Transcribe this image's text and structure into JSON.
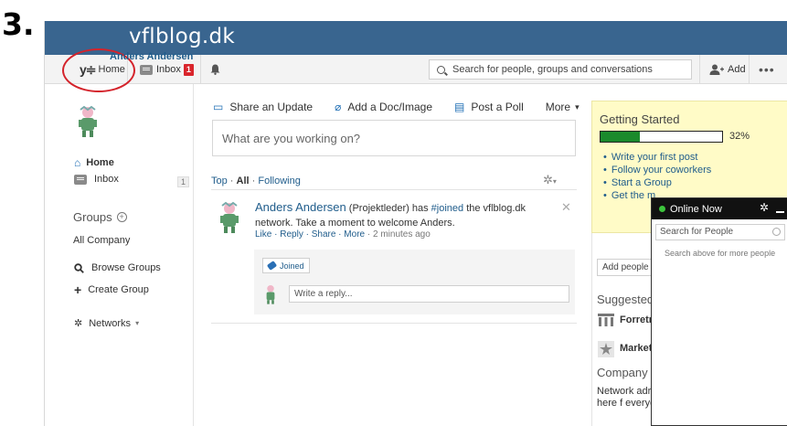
{
  "step_number": "3.",
  "brand": {
    "title": "vflblog.dk"
  },
  "topnav": {
    "home_label": "Home",
    "logo_text": "y≑",
    "inbox_label": "Inbox",
    "inbox_badge": "1",
    "search_placeholder": "Search for people, groups and conversations",
    "add_label": "Add",
    "more_label": "•••"
  },
  "sidebar": {
    "profile_name": "Anders Andersen",
    "home_label": "Home",
    "inbox_label": "Inbox",
    "inbox_count": "1",
    "groups_heading": "Groups",
    "all_company": "All Company",
    "browse_groups": "Browse Groups",
    "create_group": "Create Group",
    "networks": "Networks"
  },
  "composer": {
    "share_update": "Share an Update",
    "add_doc": "Add a Doc/Image",
    "post_poll": "Post a Poll",
    "more": "More",
    "placeholder": "What are you working on?"
  },
  "feed_filter": {
    "top": "Top",
    "sep1": " · ",
    "all": "All",
    "sep2": " · ",
    "following": "Following"
  },
  "post": {
    "author": "Anders Andersen",
    "role": " (Projektleder) has ",
    "hashtag": "#joined",
    "text_rest": " the vflblog.dk network. Take a moment to welcome Anders.",
    "like": "Like",
    "reply": "Reply",
    "share": "Share",
    "more": "More",
    "time": "2 minutes ago",
    "tag": "Joined",
    "reply_placeholder": "Write a reply..."
  },
  "getting_started": {
    "title": "Getting Started",
    "progress": 0.32,
    "progress_label": "32%",
    "items": [
      "Write your first post",
      "Follow your coworkers",
      "Start a Group",
      "Get the m"
    ]
  },
  "right_col": {
    "add_people": "Add people t",
    "suggested_heading": "Suggested",
    "suggested_1": "Forretr",
    "suggested_2": "Market",
    "company_heading": "Company",
    "company_text": "Network adr Notes here f everyone in"
  },
  "online_now": {
    "title": "Online Now",
    "search_placeholder": "Search for People",
    "hint": "Search above for more people"
  },
  "colors": {
    "brand": "#39658f",
    "link": "#1f5c8b",
    "badge": "#d9252c",
    "progress": "#1b8a2c",
    "highlight": "#d4232b"
  }
}
